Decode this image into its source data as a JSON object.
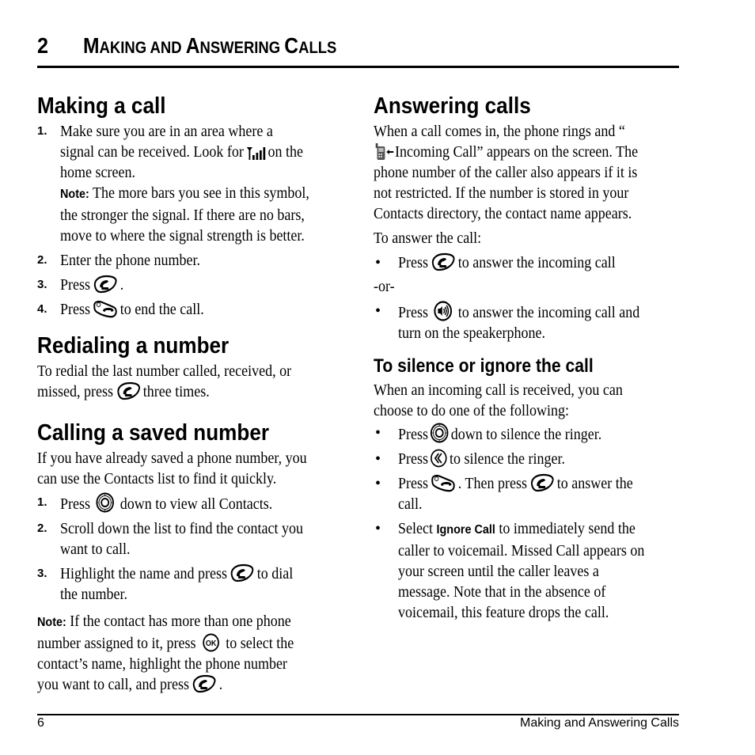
{
  "chapter": {
    "number": "2",
    "title_parts": [
      {
        "cap": "M",
        "rest": "AKING AND "
      },
      {
        "cap": "A",
        "rest": "NSWERING "
      },
      {
        "cap": "C",
        "rest": "ALLS"
      }
    ]
  },
  "left": {
    "making": {
      "heading": "Making a call",
      "step1_num": "1.",
      "step1_a": "Make sure you are in an area where a signal can be received. Look for",
      "step1_b": "on the home screen.",
      "step1_note_label": "Note:",
      "step1_note": "The more bars you see in this symbol, the stronger the signal. If there are no bars, move to where the signal strength is better.",
      "step2_num": "2.",
      "step2": "Enter the phone number.",
      "step3_num": "3.",
      "step3_a": "Press",
      "step3_b": ".",
      "step4_num": "4.",
      "step4_a": "Press",
      "step4_b": "to end the call."
    },
    "redial": {
      "heading": "Redialing a number",
      "text_a": "To redial the last number called, received, or missed, press",
      "text_b": "three times."
    },
    "saved": {
      "heading": "Calling a saved number",
      "intro": "If you have already saved a phone number, you can use the Contacts list to find it quickly.",
      "step1_num": "1.",
      "step1_a": "Press",
      "step1_b": "down to view all Contacts.",
      "step2_num": "2.",
      "step2": "Scroll down the list to find the contact you want to call.",
      "step3_num": "3.",
      "step3_a": "Highlight the name and press",
      "step3_b": "to dial the number.",
      "note_label": "Note:",
      "note_a": "If the contact has more than one phone number assigned to it, press",
      "note_b": "to select the contact’s name, highlight the phone number you want to call, and press",
      "note_c": "."
    }
  },
  "right": {
    "answering": {
      "heading": "Answering calls",
      "intro_a": "When a call comes in, the phone rings and “",
      "intro_b": "Incoming Call” appears on the screen. The phone number of the caller also appears if it is not restricted. If the number is stored in your Contacts directory, the contact name appears.",
      "to_answer": "To answer the call:",
      "bullet1_a": "Press",
      "bullet1_b": "to answer the incoming call",
      "or": "-or-",
      "bullet2_a": "Press",
      "bullet2_b": "to answer the incoming call and turn on the speakerphone."
    },
    "silence": {
      "heading": "To silence or ignore the call",
      "intro": "When an incoming call is received, you can choose to do one of the following:",
      "bullet1_a": "Press",
      "bullet1_b": "down to silence the ringer.",
      "bullet2_a": "Press",
      "bullet2_b": "to silence the ringer.",
      "bullet3_a": "Press",
      "bullet3_b": ". Then press",
      "bullet3_c": "to answer the call.",
      "bullet4_a": "Select",
      "bullet4_bold": "Ignore Call",
      "bullet4_b": "to immediately send the caller to voicemail. Missed Call appears on your screen until the caller leaves a message. Note that in the absence of voicemail, this feature drops the call."
    }
  },
  "footer": {
    "page_number": "6",
    "section_title": "Making and Answering Calls"
  },
  "bullet_char": "•"
}
